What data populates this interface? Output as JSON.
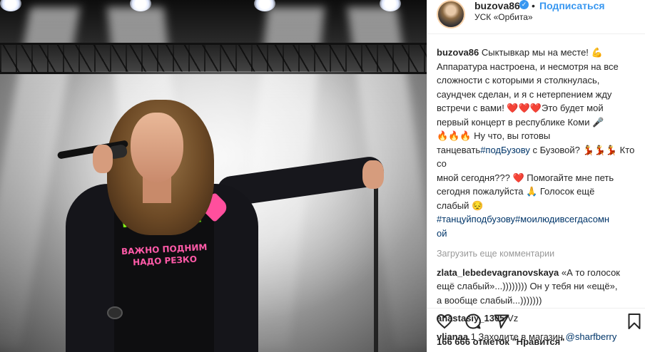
{
  "post": {
    "username": "buzova86",
    "follow_label": "Подписаться",
    "dot": "•",
    "location": "УСК «Орбита»",
    "verified_icon": "verified-check-icon"
  },
  "photo": {
    "shirt_graffiti": "ГРОШКА",
    "shirt_text": "ВАЖНО ПОДНИМ\nНАДО РЕЗКО"
  },
  "caption": {
    "author": "buzova86",
    "text": "Сыктывкар мы на месте! 💪\nАппаратура настроена, и несмотря на все\nсложности с которыми я столкнулась,\nсаундчек сделан, и я с нетерпением жду\nвстречи с вами! ❤️❤️❤️Это будет мой\nпервый концерт в республике Коми 🎤\n🔥🔥🔥 Ну что, вы готовы танцевать",
    "tag_inline": "#подБузову",
    "text2": " с Бузовой? 💃💃💃 Кто со\nмной сегодня??? ❤️ Помогайте мне петь\nсегодня пожалуйста 🙏 Голосок ещё\nслабый 😔",
    "tags": "#танцуйподбузову#моилюдивсегдасомн\nой"
  },
  "load_more": "Загрузить еще комментарии",
  "comments": [
    {
      "author": "zlata_lebedevagranovskaya",
      "text": " «А то голосок\nещё слабый»...)))))))) Он у тебя ни «ещё»,\nа вообще слабый...)))))))"
    },
    {
      "author": "anastasiy_1305",
      "text": " Vz"
    },
    {
      "author": "vlianaa",
      "text": " 1 Заходите в магазин ",
      "mention": "@sharfberry"
    }
  ],
  "actions": {
    "like_icon": "heart-icon",
    "comment_icon": "comment-icon",
    "share_icon": "share-icon",
    "save_icon": "bookmark-icon"
  },
  "likes_text": "166 666 отметок \"Нравится\"",
  "colors": {
    "accent": "#3897f0",
    "tag": "#003569",
    "muted": "#999999",
    "text": "#262626"
  }
}
